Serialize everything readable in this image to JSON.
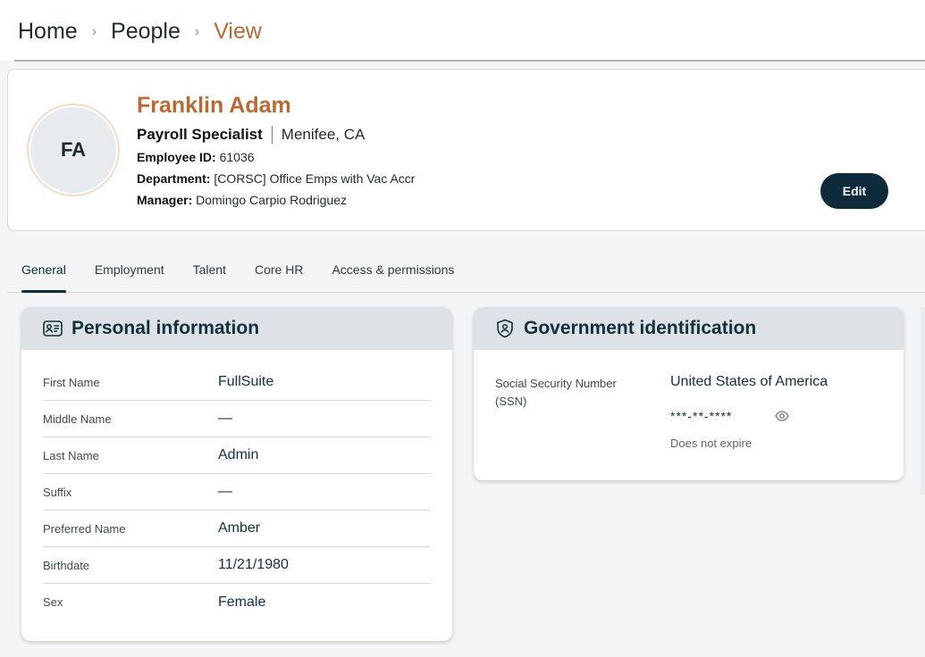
{
  "breadcrumb": {
    "items": [
      "Home",
      "People",
      "View"
    ],
    "separator": "›"
  },
  "profile": {
    "initials": "FA",
    "name": "Franklin Adam",
    "title": "Payroll Specialist",
    "location": "Menifee, CA",
    "employee_id_label": "Employee ID:",
    "employee_id": "61036",
    "department_label": "Department:",
    "department": "[CORSC] Office Emps with Vac Accr",
    "manager_label": "Manager:",
    "manager": "Domingo Carpio Rodriguez",
    "edit_label": "Edit"
  },
  "tabs": [
    {
      "label": "General",
      "active": true
    },
    {
      "label": "Employment",
      "active": false
    },
    {
      "label": "Talent",
      "active": false
    },
    {
      "label": "Core HR",
      "active": false
    },
    {
      "label": "Access & permissions",
      "active": false
    }
  ],
  "personal_info": {
    "title": "Personal information",
    "icon": "id-card-icon",
    "rows": [
      {
        "label": "First Name",
        "value": "FullSuite"
      },
      {
        "label": "Middle Name",
        "value": "—"
      },
      {
        "label": "Last Name",
        "value": "Admin"
      },
      {
        "label": "Suffix",
        "value": "—"
      },
      {
        "label": "Preferred Name",
        "value": "Amber"
      },
      {
        "label": "Birthdate",
        "value": "11/21/1980"
      },
      {
        "label": "Sex",
        "value": "Female"
      }
    ]
  },
  "government_id": {
    "title": "Government identification",
    "icon": "shield-user-icon",
    "ssn_label": "Social Security Number (SSN)",
    "country": "United States of America",
    "masked_value": "***-**-****",
    "expiry": "Does not expire"
  },
  "colors": {
    "accent": "#b86a35",
    "primary": "#0d2b3a",
    "card_header": "#dde2e6"
  }
}
